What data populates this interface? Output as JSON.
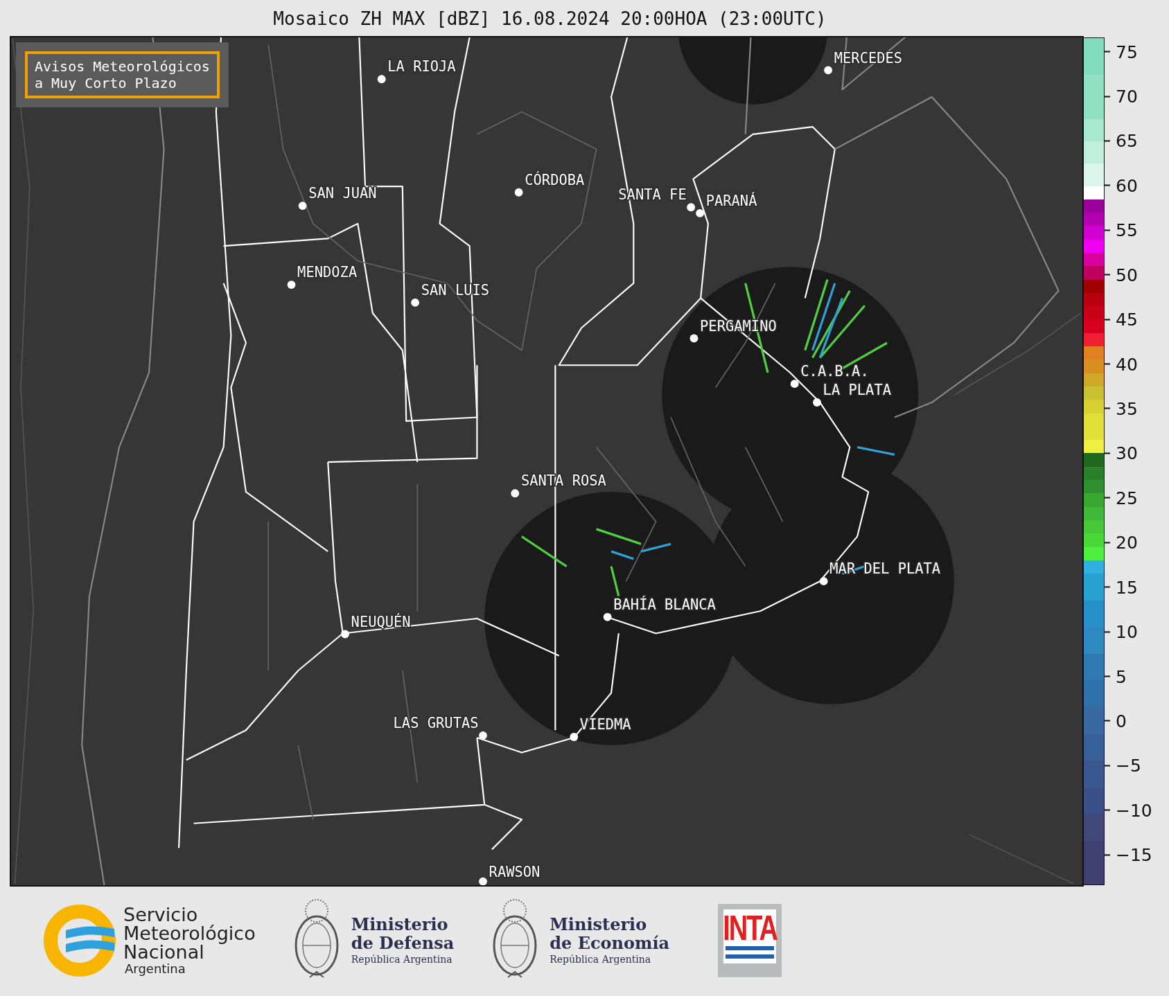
{
  "title": "Mosaico ZH MAX [dBZ] 16.08.2024 20:00HOA (23:00UTC)",
  "notice": {
    "lines": [
      "Avisos Meteorológicos",
      "a Muy Corto Plazo"
    ]
  },
  "cities": [
    {
      "name": "LA RIOJA"
    },
    {
      "name": "MERCEDES"
    },
    {
      "name": "CÓRDOBA"
    },
    {
      "name": "SAN JUAN"
    },
    {
      "name": "SANTA FE"
    },
    {
      "name": "PARANÁ"
    },
    {
      "name": "MENDOZA"
    },
    {
      "name": "SAN LUIS"
    },
    {
      "name": "PERGAMINO"
    },
    {
      "name": "C.A.B.A."
    },
    {
      "name": "LA PLATA"
    },
    {
      "name": "SANTA ROSA"
    },
    {
      "name": "MAR DEL PLATA"
    },
    {
      "name": "BAHÍA BLANCA"
    },
    {
      "name": "NEUQUÉN"
    },
    {
      "name": "LAS GRUTAS"
    },
    {
      "name": "VIEDMA"
    },
    {
      "name": "RAWSON"
    }
  ],
  "colorbar": {
    "ticks": [
      "75",
      "70",
      "65",
      "60",
      "55",
      "50",
      "45",
      "40",
      "35",
      "30",
      "25",
      "20",
      "15",
      "10",
      "5",
      "0",
      "−5",
      "−10",
      "−15"
    ]
  },
  "footer": {
    "smn": {
      "lines": [
        "Servicio",
        "Meteorológico",
        "Nacional"
      ],
      "country": "Argentina"
    },
    "ministries": [
      {
        "title": [
          "Ministerio",
          "de Defensa"
        ],
        "subtitle": "República Argentina"
      },
      {
        "title": [
          "Ministerio",
          "de Economía"
        ],
        "subtitle": "República Argentina"
      }
    ],
    "inta": "INTA"
  }
}
